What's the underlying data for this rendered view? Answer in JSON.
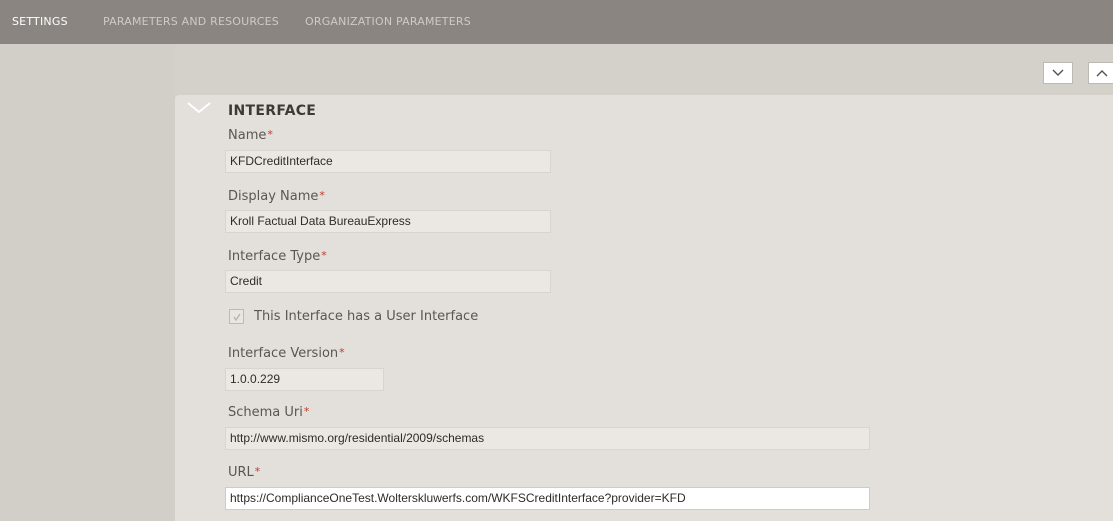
{
  "tabs": [
    {
      "label": "SETTINGS",
      "active": true
    },
    {
      "label": "PARAMETERS AND RESOURCES",
      "active": false
    },
    {
      "label": "ORGANIZATION PARAMETERS",
      "active": false
    }
  ],
  "controls": {
    "expand_icon": "chevron-down-icon",
    "collapse_icon": "chevron-up-icon"
  },
  "section": {
    "title": "INTERFACE",
    "icon": "chevron-down-icon"
  },
  "fields": {
    "name": {
      "label": "Name",
      "required": "*",
      "value": "KFDCreditInterface"
    },
    "display_name": {
      "label": "Display Name",
      "required": "*",
      "value": "Kroll Factual Data BureauExpress"
    },
    "interface_type": {
      "label": "Interface Type",
      "required": "*",
      "value": "Credit"
    },
    "has_ui": {
      "label": "This Interface has a User Interface",
      "checked": true
    },
    "interface_version": {
      "label": "Interface Version",
      "required": "*",
      "value": "1.0.0.229"
    },
    "schema_uri": {
      "label": "Schema Uri",
      "required": "*",
      "value": "http://www.mismo.org/residential/2009/schemas"
    },
    "url": {
      "label": "URL",
      "required": "*",
      "value": "https://ComplianceOneTest.Wolterskluwerfs.com/WKFSCreditInterface?provider=KFD"
    }
  },
  "colors": {
    "tabbar": "#8a8580",
    "panel": "#e3e0dc",
    "required": "#c0392b"
  }
}
